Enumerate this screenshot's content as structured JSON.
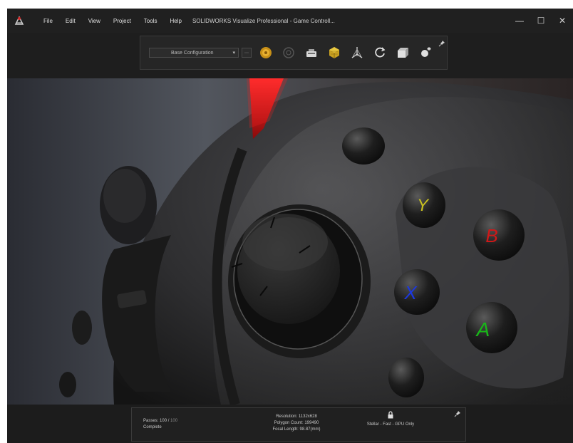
{
  "titlebar": {
    "menu": [
      "File",
      "Edit",
      "View",
      "Project",
      "Tools",
      "Help"
    ],
    "title": "SOLIDWORKS Visualize Professional - Game Controll..."
  },
  "window_controls": {
    "minimize": "—",
    "maximize": "☐",
    "close": "✕"
  },
  "toolbar": {
    "configuration": "Base Configuration",
    "tools": [
      "render-mode-icon",
      "preview-icon",
      "camera-icon",
      "cube-icon",
      "geometry-icon",
      "refresh-icon",
      "scene-icon",
      "sun-icon"
    ]
  },
  "status": {
    "passes_label": "Passes:",
    "passes_value": "100 /",
    "passes_total": "100",
    "state": "Complete",
    "resolution": "Resolution: 1132x628",
    "polygon_count": "Polygon Count: 199490",
    "focal_length": "Focal Length: 98.87(mm)",
    "render_mode": "Stellar - Fast - GPU Only"
  },
  "viewport": {
    "button_labels": {
      "y": "Y",
      "b": "B",
      "x": "X",
      "a": "A"
    },
    "button_colors": {
      "y": "#c8c020",
      "b": "#d01818",
      "x": "#1c38e0",
      "a": "#18b818"
    }
  }
}
